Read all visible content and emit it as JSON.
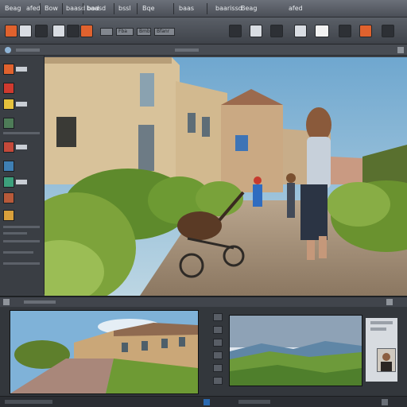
{
  "menu": {
    "items": [
      "Beag",
      "afed",
      "Bow",
      "baasd bod",
      "baasd",
      "bssl",
      "Bqe",
      "baas",
      "baarissd"
    ]
  },
  "toolbar": {
    "buttons": [
      "undo-icon",
      "crop-icon",
      "layers-icon",
      "brush-icon",
      "image-icon",
      "color-icon",
      "text-icon",
      "rotate-icon",
      "select-icon",
      "zoom-icon",
      "fill-icon",
      "clone-icon",
      "eraser-icon",
      "export-icon"
    ],
    "fields": [
      "Fba",
      "Bmbs",
      "Bfanr"
    ]
  },
  "left_panel": {
    "items": [
      "history-icon",
      "adjust-icon",
      "filter-icon",
      "layer-icon",
      "mask-icon",
      "channel-icon",
      "path-icon",
      "swatch-icon",
      "brush-preset-icon",
      "style-icon"
    ]
  },
  "canvas": {
    "scene": "photo-of-woman-with-stroller-in-village-street"
  },
  "bottom": {
    "frames": [
      "village-street-photo",
      "green-hills-landscape-photo",
      "portrait-thumbnail"
    ]
  },
  "colors": {
    "accent": "#e0622e",
    "chrome_dark": "#3b3f45",
    "chrome_light": "#6b7079"
  }
}
